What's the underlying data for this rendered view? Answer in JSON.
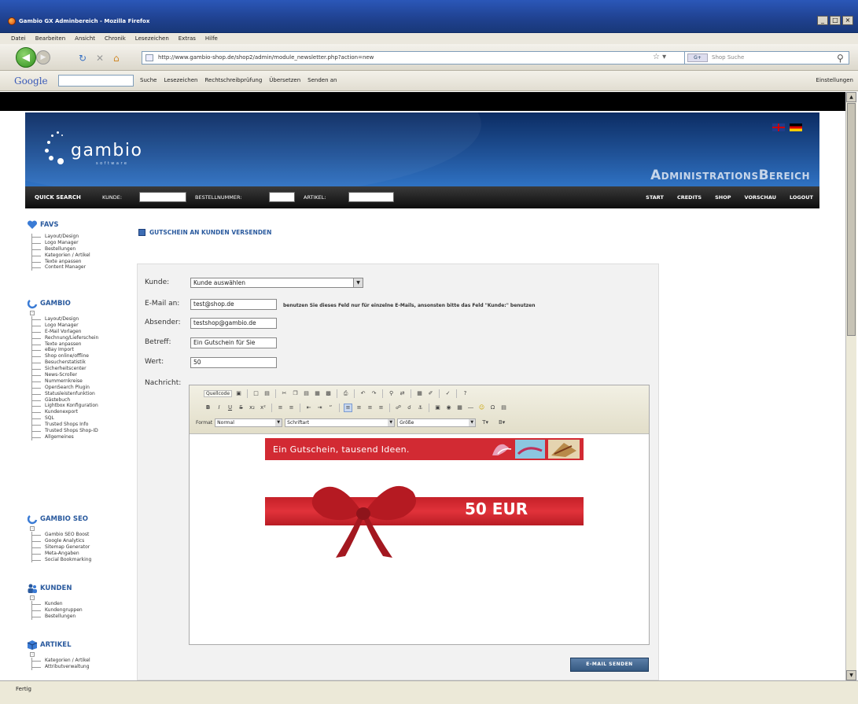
{
  "window": {
    "title": "Gambio GX Adminbereich - Mozilla Firefox",
    "controls": [
      "_",
      "□",
      "×"
    ]
  },
  "menu": [
    "Datei",
    "Bearbeiten",
    "Ansicht",
    "Chronik",
    "Lesezeichen",
    "Extras",
    "Hilfe"
  ],
  "nav": {
    "url": "http://www.gambio-shop.de/shop2/admin/module_newsletter.php?action=new",
    "search_placeholder": "Shop Suche",
    "search_engine": "G+"
  },
  "google_toolbar": {
    "logo": "Google",
    "items": [
      "Suche",
      "Lesezeichen",
      "Rechtschreibprüfung",
      "Übersetzen",
      "Senden an"
    ],
    "right": "Einstellungen"
  },
  "status": {
    "text": "Fertig"
  },
  "admin": {
    "logo_word": "gambio",
    "logo_sub": "software",
    "title": "AdministrationsBereich",
    "quick_search": "QUICK SEARCH",
    "qs_labels": [
      "KUNDE:",
      "BESTELLNUMMER:",
      "ARTIKEL:"
    ],
    "nav_links": [
      "START",
      "CREDITS",
      "SHOP",
      "VORSCHAU",
      "LOGOUT"
    ]
  },
  "sidebar": {
    "favs": {
      "title": "FAVS",
      "items": [
        "Layout/Design",
        "Logo Manager",
        "Bestellungen",
        "Kategorien / Artikel",
        "Texte anpassen",
        "Content Manager"
      ]
    },
    "gambio": {
      "title": "GAMBIO",
      "items": [
        "Layout/Design",
        "Logo Manager",
        "E-Mail Vorlagen",
        "Rechnung/Lieferschein",
        "Texte anpassen",
        "eBay Import",
        "Shop online/offline",
        "Besucherstatistik",
        "Sicherheitscenter",
        "News-Scroller",
        "Nummernkreise",
        "OpenSearch Plugin",
        "Statusleistenfunktion",
        "Gästebuch",
        "Lightbox Konfiguration",
        "Kundenexport",
        "SQL",
        "Trusted Shops Info",
        "Trusted Shops Shop-ID",
        "Allgemeines"
      ]
    },
    "seo": {
      "title": "GAMBIO SEO",
      "items": [
        "Gambio SEO Boost",
        "Google Analytics",
        "Sitemap Generator",
        "Meta-Angaben",
        "Social Bookmarking"
      ]
    },
    "kunden": {
      "title": "KUNDEN",
      "items": [
        "Kunden",
        "Kundengruppen",
        "Bestellungen"
      ]
    },
    "artikel": {
      "title": "ARTIKEL",
      "items": [
        "Kategorien / Artikel",
        "Attributverwaltung"
      ]
    }
  },
  "page": {
    "heading": "GUTSCHEIN AN KUNDEN VERSENDEN",
    "form": {
      "kunde_label": "Kunde:",
      "kunde_value": "Kunde auswählen",
      "email_label": "E-Mail an:",
      "email_value": "test@shop.de",
      "email_hint": "benutzen Sie dieses Feld nur für einzelne E-Mails, ansonsten bitte das Feld \"Kunde:\" benutzen",
      "absender_label": "Absender:",
      "absender_value": "testshop@gambio.de",
      "betreff_label": "Betreff:",
      "betreff_value": "Ein Gutschein für Sie",
      "wert_label": "Wert:",
      "wert_value": "50",
      "nachricht_label": "Nachricht:",
      "submit_label": "E-MAIL SENDEN"
    },
    "editor": {
      "source_label": "Quellcode",
      "format_label": "Format",
      "format_value": "Normal",
      "font_label": "Schriftart",
      "size_label": "Größe",
      "banner_text": "Ein Gutschein, tausend Ideen.",
      "voucher_amount": "50 EUR"
    }
  },
  "colors": {
    "accent": "#2a5a9e",
    "banner_red": "#d22a33",
    "header_blue": "#1f5196"
  }
}
